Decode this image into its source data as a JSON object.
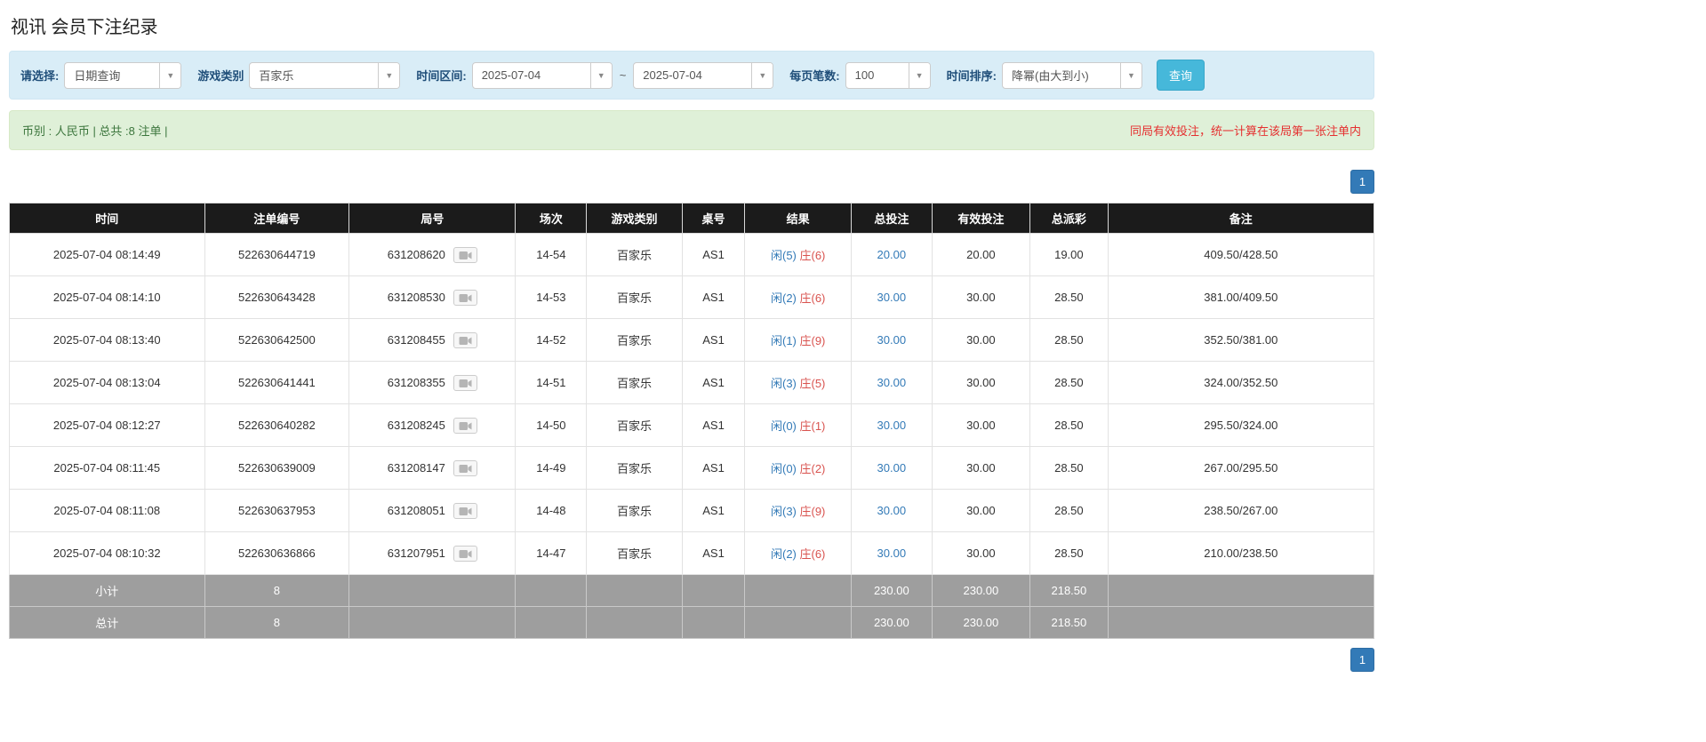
{
  "page": {
    "title": "视讯 会员下注纪录"
  },
  "colors": {
    "filter_bar_bg": "#d9edf7",
    "summary_bar_bg": "#dff0d8",
    "accent_blue": "#337ab7",
    "search_button_bg": "#46b8da",
    "player_blue": "#337ab7",
    "banker_red": "#d9534f",
    "note_red": "#e53030",
    "table_header_bg": "#1b1b1b",
    "footer_row_bg": "#9e9e9e"
  },
  "filters": {
    "select_label": "请选择:",
    "select_value": "日期查询",
    "game_type_label": "游戏类别",
    "game_type_value": "百家乐",
    "time_range_label": "时间区间:",
    "date_from": "2025-07-04",
    "range_separator": "~",
    "date_to": "2025-07-04",
    "per_page_label": "每页笔数:",
    "per_page_value": "100",
    "sort_label": "时间排序:",
    "sort_value": "降幂(由大到小)",
    "search_button_label": "查询"
  },
  "summary": {
    "left_text": "币别 : 人民币 | 总共 :8 注单 |",
    "right_note": "同局有效投注，统一计算在该局第一张注单内"
  },
  "pagination": {
    "page_label": "1"
  },
  "table": {
    "headers": [
      "时间",
      "注单编号",
      "局号",
      "场次",
      "游戏类别",
      "桌号",
      "结果",
      "总投注",
      "有效投注",
      "总派彩",
      "备注"
    ],
    "rows": [
      {
        "time": "2025-07-04 08:14:49",
        "bet_id": "522630644719",
        "round_id": "631208620",
        "session": "14-54",
        "game": "百家乐",
        "table_no": "AS1",
        "result_player": "闲(5)",
        "result_banker": "庄(6)",
        "total_bet": "20.00",
        "valid_bet": "20.00",
        "payout": "19.00",
        "remark": "409.50/428.50"
      },
      {
        "time": "2025-07-04 08:14:10",
        "bet_id": "522630643428",
        "round_id": "631208530",
        "session": "14-53",
        "game": "百家乐",
        "table_no": "AS1",
        "result_player": "闲(2)",
        "result_banker": "庄(6)",
        "total_bet": "30.00",
        "valid_bet": "30.00",
        "payout": "28.50",
        "remark": "381.00/409.50"
      },
      {
        "time": "2025-07-04 08:13:40",
        "bet_id": "522630642500",
        "round_id": "631208455",
        "session": "14-52",
        "game": "百家乐",
        "table_no": "AS1",
        "result_player": "闲(1)",
        "result_banker": "庄(9)",
        "total_bet": "30.00",
        "valid_bet": "30.00",
        "payout": "28.50",
        "remark": "352.50/381.00"
      },
      {
        "time": "2025-07-04 08:13:04",
        "bet_id": "522630641441",
        "round_id": "631208355",
        "session": "14-51",
        "game": "百家乐",
        "table_no": "AS1",
        "result_player": "闲(3)",
        "result_banker": "庄(5)",
        "total_bet": "30.00",
        "valid_bet": "30.00",
        "payout": "28.50",
        "remark": "324.00/352.50"
      },
      {
        "time": "2025-07-04 08:12:27",
        "bet_id": "522630640282",
        "round_id": "631208245",
        "session": "14-50",
        "game": "百家乐",
        "table_no": "AS1",
        "result_player": "闲(0)",
        "result_banker": "庄(1)",
        "total_bet": "30.00",
        "valid_bet": "30.00",
        "payout": "28.50",
        "remark": "295.50/324.00"
      },
      {
        "time": "2025-07-04 08:11:45",
        "bet_id": "522630639009",
        "round_id": "631208147",
        "session": "14-49",
        "game": "百家乐",
        "table_no": "AS1",
        "result_player": "闲(0)",
        "result_banker": "庄(2)",
        "total_bet": "30.00",
        "valid_bet": "30.00",
        "payout": "28.50",
        "remark": "267.00/295.50"
      },
      {
        "time": "2025-07-04 08:11:08",
        "bet_id": "522630637953",
        "round_id": "631208051",
        "session": "14-48",
        "game": "百家乐",
        "table_no": "AS1",
        "result_player": "闲(3)",
        "result_banker": "庄(9)",
        "total_bet": "30.00",
        "valid_bet": "30.00",
        "payout": "28.50",
        "remark": "238.50/267.00"
      },
      {
        "time": "2025-07-04 08:10:32",
        "bet_id": "522630636866",
        "round_id": "631207951",
        "session": "14-47",
        "game": "百家乐",
        "table_no": "AS1",
        "result_player": "闲(2)",
        "result_banker": "庄(6)",
        "total_bet": "30.00",
        "valid_bet": "30.00",
        "payout": "28.50",
        "remark": "210.00/238.50"
      }
    ],
    "subtotal": {
      "label": "小计",
      "count": "8",
      "total_bet": "230.00",
      "valid_bet": "230.00",
      "payout": "218.50"
    },
    "grand_total": {
      "label": "总计",
      "count": "8",
      "total_bet": "230.00",
      "valid_bet": "230.00",
      "payout": "218.50"
    }
  }
}
